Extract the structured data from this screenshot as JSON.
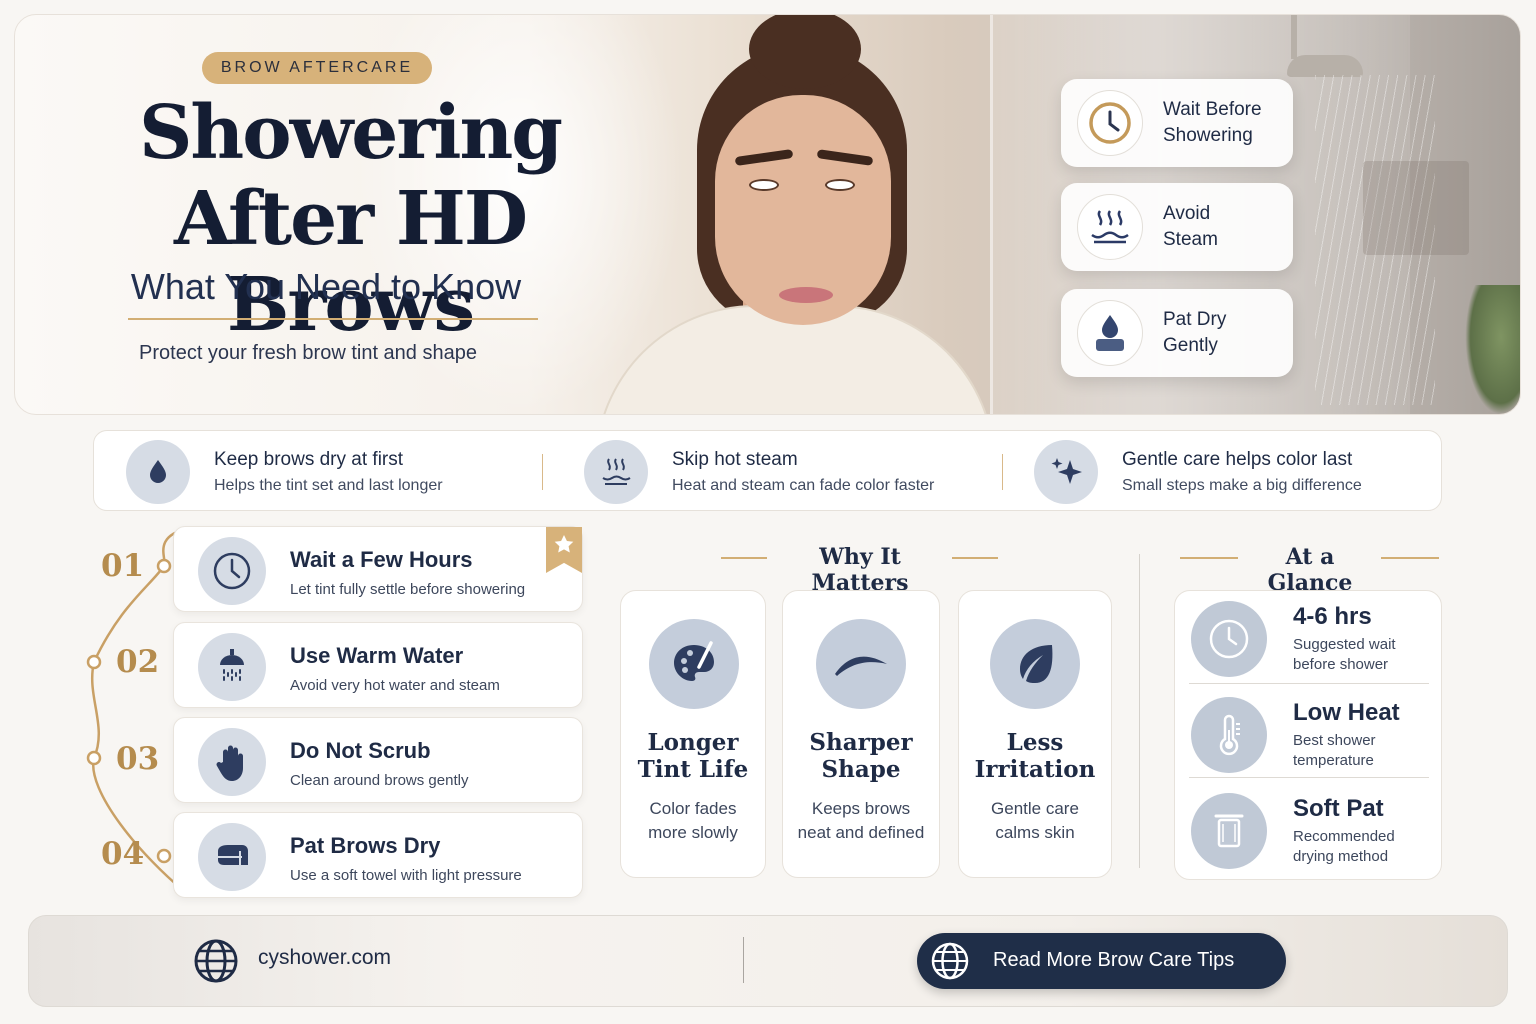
{
  "hero": {
    "badge": "BROW AFTERCARE",
    "title_line1": "Showering",
    "title_line2": "After HD Brows",
    "subtitle": "What You Need to Know",
    "tagline": "Protect your fresh brow tint and shape",
    "tips": [
      {
        "label": "Wait Before\nShowering",
        "icon": "clock-icon"
      },
      {
        "label": "Avoid\nSteam",
        "icon": "steam-icon"
      },
      {
        "label": "Pat Dry\nGently",
        "icon": "towel-drop-icon"
      }
    ]
  },
  "benefits": [
    {
      "title": "Keep brows dry at first",
      "desc": "Helps the tint set and last longer",
      "icon": "water-drop-icon"
    },
    {
      "title": "Skip hot steam",
      "desc": "Heat and steam can fade color faster",
      "icon": "steam-icon"
    },
    {
      "title": "Gentle care helps color last",
      "desc": "Small steps make a big difference",
      "icon": "sparkle-icon"
    }
  ],
  "steps": [
    {
      "num": "01",
      "title": "Wait a Few Hours",
      "desc": "Let tint fully settle before showering",
      "icon": "clock-icon"
    },
    {
      "num": "02",
      "title": "Use Warm Water",
      "desc": "Avoid very hot water and steam",
      "icon": "shower-head-icon"
    },
    {
      "num": "03",
      "title": "Do Not Scrub",
      "desc": "Clean around brows gently",
      "icon": "hand-icon"
    },
    {
      "num": "04",
      "title": "Pat Brows Dry",
      "desc": "Use a soft towel with light pressure",
      "icon": "towel-icon"
    }
  ],
  "why": {
    "heading": "Why It Matters",
    "cards": [
      {
        "title": "Longer\nTint Life",
        "desc": "Color fades\nmore slowly",
        "icon": "palette-icon"
      },
      {
        "title": "Sharper\nShape",
        "desc": "Keeps brows\nneat and defined",
        "icon": "eyebrow-icon"
      },
      {
        "title": "Less\nIrritation",
        "desc": "Gentle care\ncalms skin",
        "icon": "leaf-icon"
      }
    ]
  },
  "glance": {
    "heading": "At a Glance",
    "rows": [
      {
        "value": "4-6 hrs",
        "desc": "Suggested wait\nbefore shower",
        "icon": "clock-icon"
      },
      {
        "value": "Low Heat",
        "desc": "Best shower\ntemperature",
        "icon": "thermometer-icon"
      },
      {
        "value": "Soft Pat",
        "desc": "Recommended\ndrying method",
        "icon": "towel-icon"
      }
    ]
  },
  "footer": {
    "site": "cyshower.com",
    "cta": "Read More Brow Care Tips"
  },
  "colors": {
    "navy": "#1f2e48",
    "gold": "#d7b27a",
    "icon_bg": "#d6dce5",
    "cream": "#f8f6f3"
  }
}
